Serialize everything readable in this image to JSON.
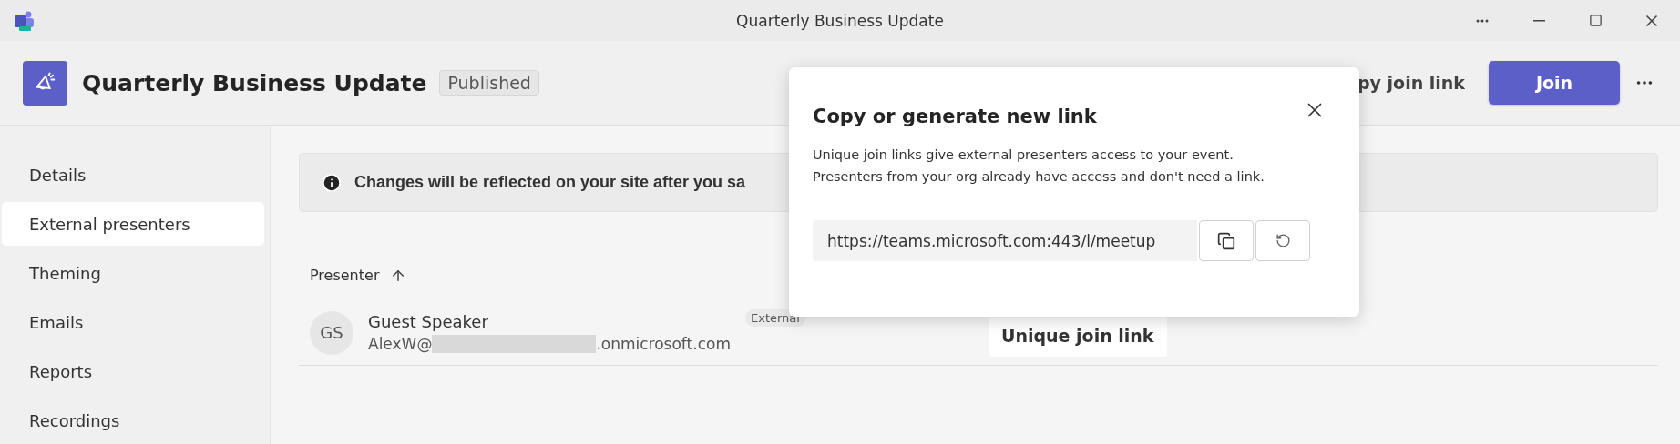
{
  "window": {
    "title": "Quarterly Business Update"
  },
  "header": {
    "title": "Quarterly Business Update",
    "status": "Published",
    "copy_link": "py join link",
    "join": "Join"
  },
  "sidebar": {
    "items": [
      {
        "label": "Details",
        "selected": false
      },
      {
        "label": "External presenters",
        "selected": true
      },
      {
        "label": "Theming",
        "selected": false
      },
      {
        "label": "Emails",
        "selected": false
      },
      {
        "label": "Reports",
        "selected": false
      },
      {
        "label": "Recordings",
        "selected": false
      }
    ]
  },
  "banner": {
    "text": "Changes will be reflected on your site after you sa"
  },
  "table": {
    "column": "Presenter",
    "rows": [
      {
        "initials": "GS",
        "name": "Guest Speaker",
        "email_start": "AlexW@",
        "email_end": ".onmicrosoft.com",
        "tag": "External",
        "action": "Unique join link"
      }
    ]
  },
  "dialog": {
    "title": "Copy or generate new link",
    "lines": [
      "Unique join links give external presenters access to your event.",
      "Presenters from your org already have access and don't need a link."
    ],
    "url": "https://teams.microsoft.com:443/l/meetup"
  }
}
